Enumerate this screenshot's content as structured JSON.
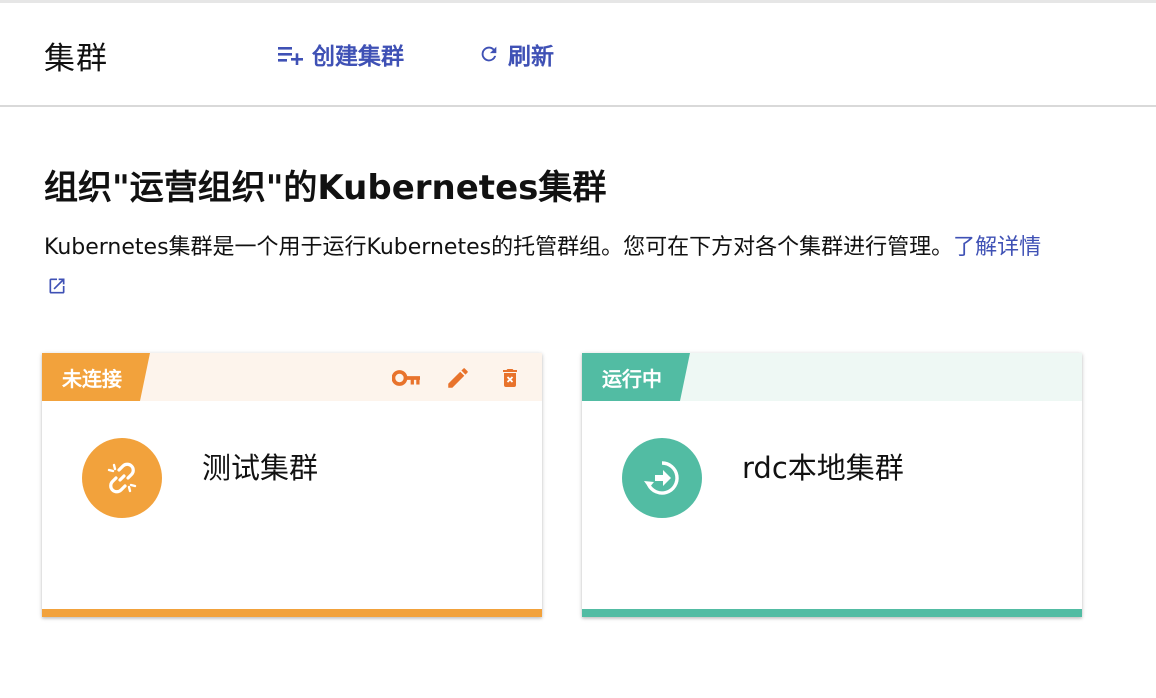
{
  "header": {
    "title": "集群",
    "create_label": "创建集群",
    "refresh_label": "刷新"
  },
  "section": {
    "title": "组织\"运营组织\"的Kubernetes集群",
    "description": "Kubernetes集群是一个用于运行Kubernetes的托管群组。您可在下方对各个集群进行管理。",
    "learn_more": "了解详情"
  },
  "clusters": [
    {
      "status": "未连接",
      "name": "测试集群",
      "status_icon": "link-off-icon",
      "actions": [
        "key-icon",
        "edit-icon",
        "delete-icon"
      ]
    },
    {
      "status": "运行中",
      "name": "rdc本地集群",
      "status_icon": "sync-running-icon",
      "actions": []
    }
  ],
  "colors": {
    "accent": "#3f51b5",
    "disconnected": "#f2a23c",
    "running": "#52bca3",
    "action_icons": "#e8732c"
  }
}
